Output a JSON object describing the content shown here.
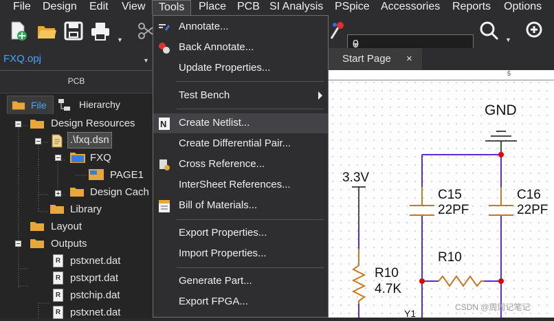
{
  "menubar": {
    "items": [
      "File",
      "Design",
      "Edit",
      "View",
      "Tools",
      "Place",
      "PCB",
      "SI Analysis",
      "PSpice",
      "Accessories",
      "Reports",
      "Options"
    ],
    "active": "Tools"
  },
  "toolbar": {
    "combo_value": "0"
  },
  "project": {
    "name": "FXQ.opj"
  },
  "panel": {
    "title": "PCB",
    "tab_file": "File",
    "tab_hierarchy": "Hierarchy",
    "tree": {
      "design_resources": "Design Resources",
      "dsn": ".\\fxq.dsn",
      "fxq": "FXQ",
      "page1": "PAGE1",
      "design_cache": "Design Cach",
      "library": "Library",
      "layout": "Layout",
      "outputs": "Outputs",
      "out1": "pstxnet.dat",
      "out2": "pstxprt.dat",
      "out3": "pstchip.dat",
      "out4": "pstxnet.dat"
    }
  },
  "doc_tabs": {
    "start_page": "Start Page",
    "close": "×"
  },
  "tools_menu": {
    "annotate": "Annotate...",
    "back_annotate": "Back Annotate...",
    "update_properties": "Update Properties...",
    "test_bench": "Test Bench",
    "create_netlist": "Create Netlist...",
    "create_diff_pair": "Create Differential Pair...",
    "cross_reference": "Cross Reference...",
    "intersheet_refs": "InterSheet References...",
    "bill_of_materials": "Bill of Materials...",
    "export_properties": "Export Properties...",
    "import_properties": "Import Properties...",
    "generate_part": "Generate Part...",
    "export_fpga": "Export FPGA..."
  },
  "schematic": {
    "ruler_mark": "5",
    "gnd": "GND",
    "v33": "3.3V",
    "c15": "C15",
    "c15_val": "22PF",
    "c16": "C16",
    "c16_val": "22PF",
    "r10_mid": "R10",
    "r10_left": "R10",
    "r10_left_val": "4.7K",
    "partial": "Y1"
  },
  "watermark": "CSDN @周周记笔记",
  "colors": {
    "accent": "#4aa3ff",
    "wire": "#5a2bd8",
    "junction": "#e00000",
    "component": "#c8781e"
  }
}
